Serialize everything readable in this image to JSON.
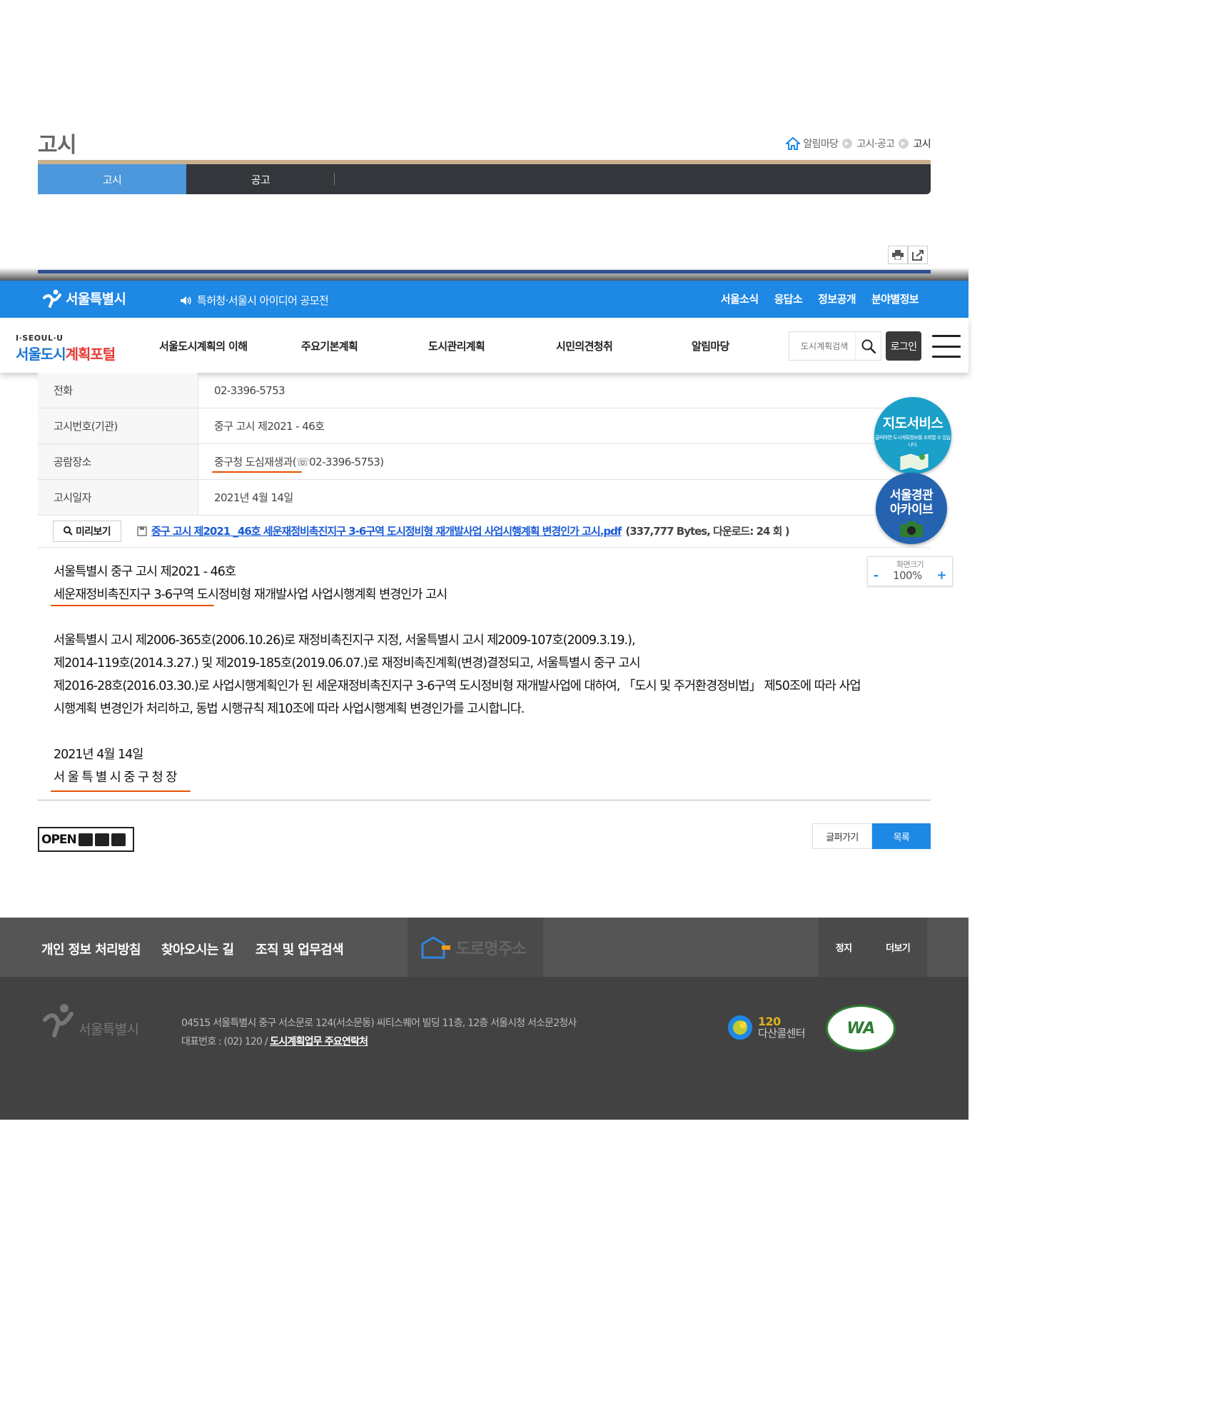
{
  "page": {
    "title": "고시",
    "breadcrumb": [
      "알림마당",
      "고시·공고",
      "고시"
    ],
    "tabs": [
      {
        "label": "고시",
        "active": true
      },
      {
        "label": "공고",
        "active": false
      }
    ]
  },
  "topbar": {
    "logo_text": "서울특별시",
    "notice": "특허청·서울시 아이디어 공모전",
    "links": [
      "서울소식",
      "응답소",
      "정보공개",
      "분야별정보"
    ]
  },
  "gnb": {
    "logo_sub": "I·SEOUL·U",
    "logo_main_a": "서울도시",
    "logo_main_b": "계획포털",
    "items": [
      "서울도시계획의 이해",
      "주요기본계획",
      "도시관리계획",
      "시민의견청취",
      "알림마당"
    ],
    "search_placeholder": "도시계획검색",
    "login_label": "로그인"
  },
  "info": {
    "rows": [
      {
        "label": "전화",
        "value": "02-3396-5753"
      },
      {
        "label": "고시번호(기관)",
        "value": "중구 고시 제2021 - 46호"
      },
      {
        "label": "공람장소",
        "value": "중구청 도심재생과(☏02-3396-5753)"
      },
      {
        "label": "고시일자",
        "value": "2021년 4월 14일"
      }
    ],
    "preview_label": "미리보기",
    "file_name": "중구 고시 제2021 _46호 세운재정비촉진지구 3-6구역 도시정비형 재개발사업 사업시행계획 변경인가 고시.pdf",
    "file_meta": "(337,777 Bytes, 다운로드: 24 회 )"
  },
  "body": {
    "line1": "서울특별시 중구 고시 제2021 - 46호",
    "line2": "세운재정비촉진지구 3-6구역 도시정비형 재개발사업 사업시행계획 변경인가 고시",
    "para1": "서울특별시 고시 제2006-365호(2006.10.26)로 재정비촉진지구 지정, 서울특별시 고시 제2009-107호(2009.3.19.),",
    "para2": "제2014-119호(2014.3.27.) 및 제2019-185호(2019.06.07.)로 재정비촉진계획(변경)결정되고, 서울특별시 중구 고시",
    "para3": "제2016-28호(2016.03.30.)로 사업시행계획인가 된 세운재정비촉진지구 3-6구역 도시정비형 재개발사업에 대하여, 「도시 및 주거환경정비법」 제50조에 따라 사업",
    "para4": "시행계획 변경인가 처리하고, 동법 시행규칙 제10조에 따라 사업시행계획 변경인가를 고시합니다.",
    "date": "2021년 4월 14일",
    "signer": "서 울 특 별 시 중 구 청 장"
  },
  "actions": {
    "open_badge": "OPEN",
    "prev_label": "글퍼가기",
    "list_label": "목록"
  },
  "floating": {
    "map_title": "지도서비스",
    "map_sub": "클릭하면 도시계획정보를 조회할 수 있습니다.",
    "archive_title_1": "서울경관",
    "archive_title_2": "아카이브",
    "zoom_label": "화면크기",
    "zoom_minus": "-",
    "zoom_value": "100%",
    "zoom_plus": "+"
  },
  "footer": {
    "links": [
      "개인 정보 처리방침",
      "찾아오시는 길",
      "조직 및 업무검색"
    ],
    "road_label": "도로명주소",
    "banner_stop": "정지",
    "banner_more": "더보기",
    "logo_text": "서울특별시",
    "address": "04515 서울특별시 중구 서소문로 124(서소문동) 씨티스퀘어 빌딩 11층, 12층 서울시청 서소문2청사",
    "phone_prefix": "대표번호 : (02) 120 / ",
    "phone_link": "도시계획업무 주요연락처",
    "call_num": "120",
    "call_name": "다산콜센터",
    "wa_text": "WA"
  },
  "colors": {
    "accent_blue": "#1e88e5",
    "tab_active": "#4d97dc",
    "tab_bar": "#33363b",
    "link": "#1a5bd8",
    "underline_annotation": "#e65100"
  }
}
